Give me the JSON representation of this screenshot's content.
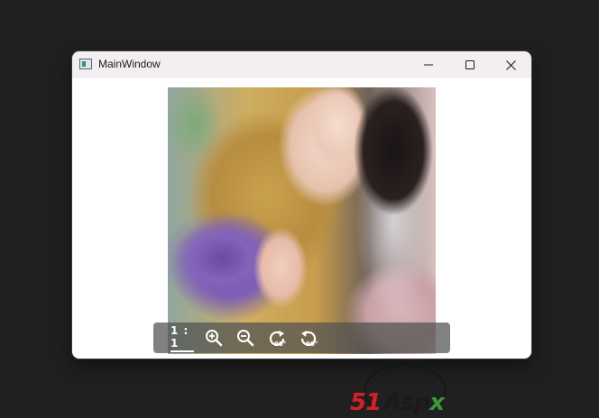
{
  "window": {
    "title": "MainWindow",
    "icon": "app-window-icon"
  },
  "window_controls": {
    "minimize_icon": "minimize-icon",
    "maximize_icon": "maximize-icon",
    "close_icon": "close-icon"
  },
  "image_viewer": {
    "image": "portrait-woman-with-lavender-flowers",
    "toolbar": {
      "actual_size_label": "1 : 1",
      "zoom_in_icon": "zoom-in-icon",
      "zoom_out_icon": "zoom-out-icon",
      "rotate_right_label": "90°",
      "rotate_left_label": "90°"
    }
  },
  "watermark": {
    "brand_number": "51",
    "brand_text": "Asp",
    "brand_tail": "x"
  },
  "colors": {
    "desktop": "#202020",
    "titlebar": "#f3eef1",
    "toolbar": "#505050",
    "watermark_red": "#d3202a",
    "watermark_green": "#3a9a3a"
  }
}
